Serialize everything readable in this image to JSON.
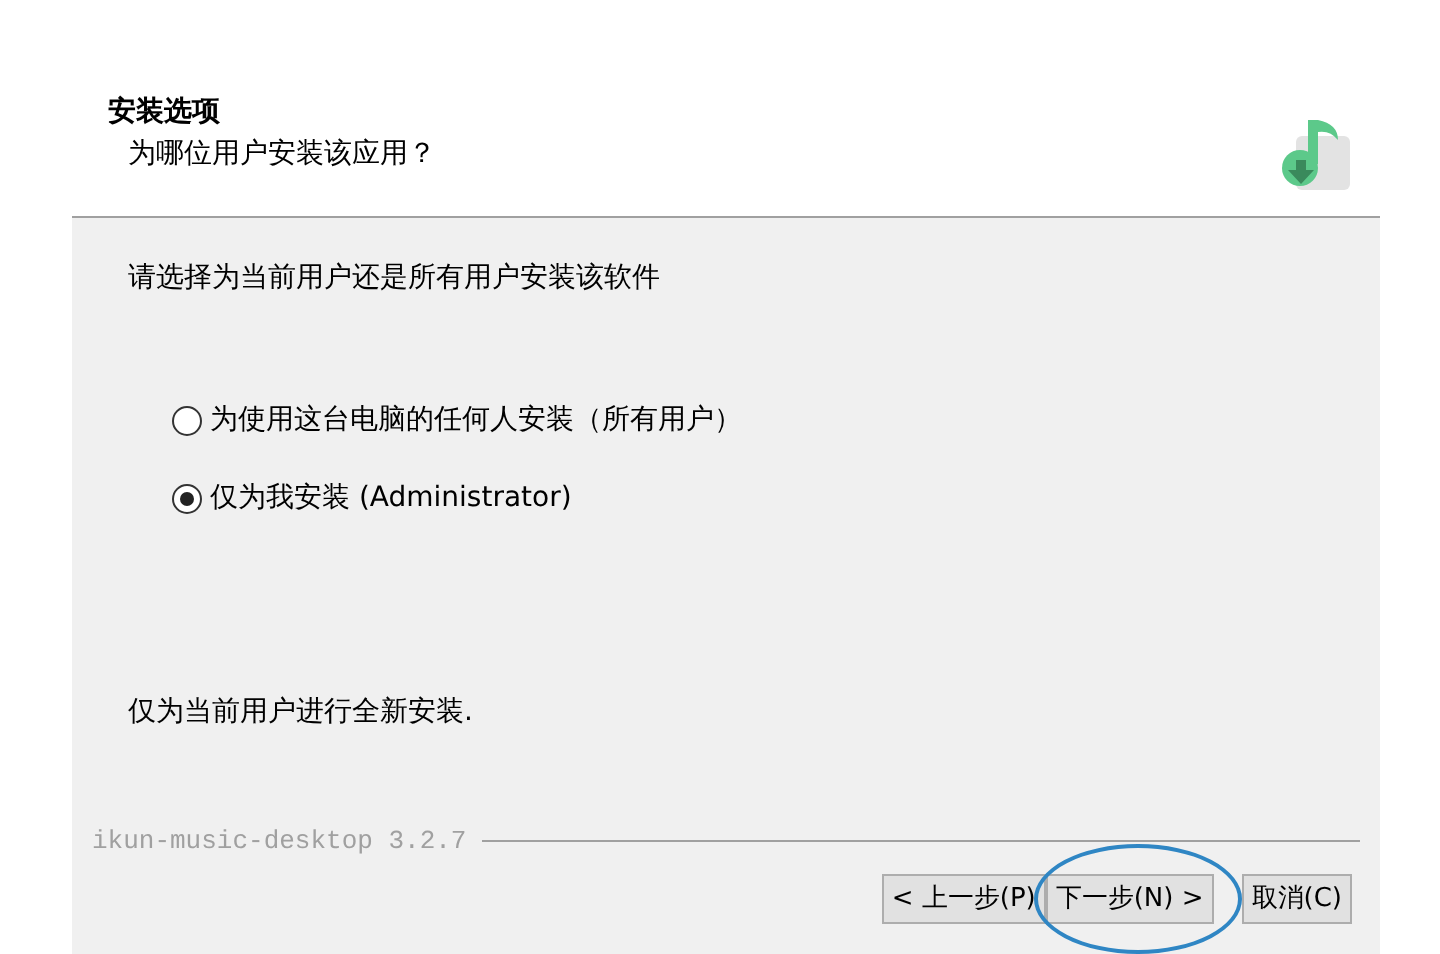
{
  "header": {
    "title": "安装选项",
    "subtitle": "为哪位用户安装该应用？"
  },
  "prompt": "请选择为当前用户还是所有用户安装该软件",
  "options": [
    {
      "label": "为使用这台电脑的任何人安装（所有用户）",
      "selected": false
    },
    {
      "label": "仅为我安装 (Administrator)",
      "selected": true
    }
  ],
  "description": "仅为当前用户进行全新安装.",
  "branding": "ikun-music-desktop 3.2.7",
  "buttons": [
    {
      "label": "< 上一步(P)",
      "highlighted": false
    },
    {
      "label": "下一步(N) >",
      "highlighted": true
    },
    {
      "label": "取消(C)",
      "highlighted": false
    }
  ]
}
